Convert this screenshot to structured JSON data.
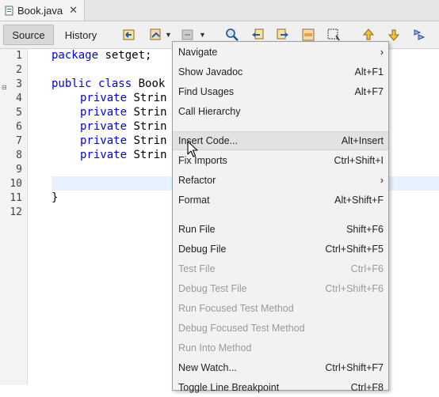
{
  "tab": {
    "title": "Book.java",
    "close": "✕"
  },
  "toolbar": {
    "source": "Source",
    "history": "History"
  },
  "gutter": {
    "lines": [
      "1",
      "2",
      "3",
      "4",
      "5",
      "6",
      "7",
      "8",
      "9",
      "10",
      "11",
      "12"
    ]
  },
  "code": {
    "l1_kw": "package",
    "l1_rest": " setget;",
    "l3_kw1": "public",
    "l3_kw2": "class",
    "l3_rest": "Book",
    "priv": "private",
    "strin": "Strin",
    "close_brace": "}"
  },
  "menu": {
    "items": [
      {
        "label": "Navigate",
        "accel": "›",
        "enabled": true
      },
      {
        "label": "Show Javadoc",
        "accel": "Alt+F1",
        "enabled": true
      },
      {
        "label": "Find Usages",
        "accel": "Alt+F7",
        "enabled": true
      },
      {
        "label": "Call Hierarchy",
        "accel": "",
        "enabled": true
      },
      {
        "label": "Insert Code...",
        "accel": "Alt+Insert",
        "enabled": true
      },
      {
        "label": "Fix Imports",
        "accel": "Ctrl+Shift+I",
        "enabled": true
      },
      {
        "label": "Refactor",
        "accel": "›",
        "enabled": true
      },
      {
        "label": "Format",
        "accel": "Alt+Shift+F",
        "enabled": true
      },
      {
        "label": "Run File",
        "accel": "Shift+F6",
        "enabled": true
      },
      {
        "label": "Debug File",
        "accel": "Ctrl+Shift+F5",
        "enabled": true
      },
      {
        "label": "Test File",
        "accel": "Ctrl+F6",
        "enabled": false
      },
      {
        "label": "Debug Test File",
        "accel": "Ctrl+Shift+F6",
        "enabled": false
      },
      {
        "label": "Run Focused Test Method",
        "accel": "",
        "enabled": false
      },
      {
        "label": "Debug Focused Test Method",
        "accel": "",
        "enabled": false
      },
      {
        "label": "Run Into Method",
        "accel": "",
        "enabled": false
      },
      {
        "label": "New Watch...",
        "accel": "Ctrl+Shift+F7",
        "enabled": true
      },
      {
        "label": "Toggle Line Breakpoint",
        "accel": "Ctrl+F8",
        "enabled": true
      }
    ]
  },
  "colors": {
    "keyword": "#0000e6",
    "highlight": "#e8f2fe"
  }
}
